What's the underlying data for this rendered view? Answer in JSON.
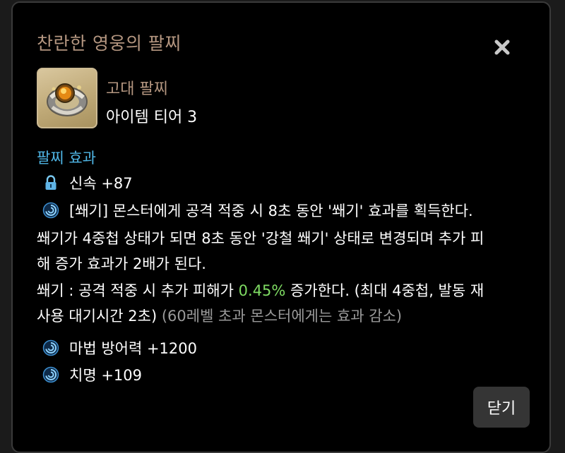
{
  "dialog": {
    "title": "찬란한 영웅의 팔찌",
    "close_icon": "close-x-icon"
  },
  "item": {
    "image_icon": "bracelet-icon",
    "grade": "고대 팔찌",
    "tier": "아이템 티어 3"
  },
  "effects": {
    "section_title": "팔찌 효과",
    "swiftness": {
      "icon": "lock-icon",
      "text": "신속 +87"
    },
    "swaegi_line1_icon": "swirl-icon",
    "swaegi_line1": "[쐐기] 몬스터에게 공격 적중 시 8초 동안 '쐐기' 효과를 획득한다.",
    "swaegi_line2": "쐐기가 4중첩 상태가 되면 8초 동안 '강철 쐐기' 상태로 변경되며 추가 피",
    "swaegi_line3": "해 증가 효과가 2배가 된다.",
    "swaegi_line4_pre": "쐐기 : 공격 적중 시 추가 피해가 ",
    "swaegi_line4_value": "0.45%",
    "swaegi_line4_post": " 증가한다. (최대 4중첩, 발동 재",
    "swaegi_line5_pre": "사용 대기시간 2초) ",
    "swaegi_line5_note": "(60레벨 초과 몬스터에게는 효과 감소)",
    "magic_defense": {
      "icon": "swirl-icon",
      "text": "마법 방어력 +1200"
    },
    "crit": {
      "icon": "swirl-icon",
      "text": "치명 +109"
    }
  },
  "footer": {
    "close_label": "닫기"
  },
  "colors": {
    "title": "#b49680",
    "section": "#4fb6e6",
    "highlight_green": "#7fdc63",
    "note_gray": "#9a9a9a",
    "button_bg": "#353535"
  }
}
